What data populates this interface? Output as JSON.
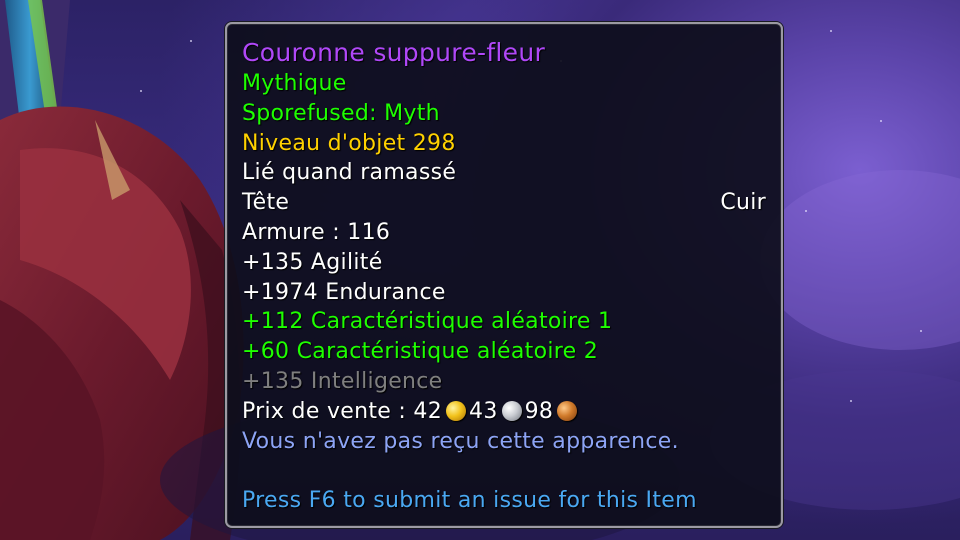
{
  "tooltip": {
    "item_name": "Couronne suppure-fleur",
    "quality": "Mythique",
    "sporefused": "Sporefused: Myth",
    "item_level": "Niveau d'objet 298",
    "binding": "Lié quand ramassé",
    "slot": "Tête",
    "armor_type": "Cuir",
    "armor": "Armure : 116",
    "stats": [
      "+135 Agilité",
      "+1974 Endurance",
      "+112 Caractéristique aléatoire 1",
      "+60 Caractéristique aléatoire 2",
      "+135 Intelligence"
    ],
    "sell_price": {
      "label": "Prix de vente :",
      "gold": "42",
      "silver": "43",
      "copper": "98"
    },
    "appearance_notice": "Vous n'avez pas reçu cette apparence.",
    "submit_issue": "Press F6 to submit an issue for this Item"
  },
  "colors": {
    "item_name": "#b048f8",
    "green_text": "#1eff00",
    "item_level": "#ffd100",
    "disabled_stat": "#7f7f7f",
    "appearance_notice": "#8da4f5",
    "submit_issue": "#4aa8f2"
  },
  "icons": [
    "gold-coin-icon",
    "silver-coin-icon",
    "copper-coin-icon"
  ]
}
